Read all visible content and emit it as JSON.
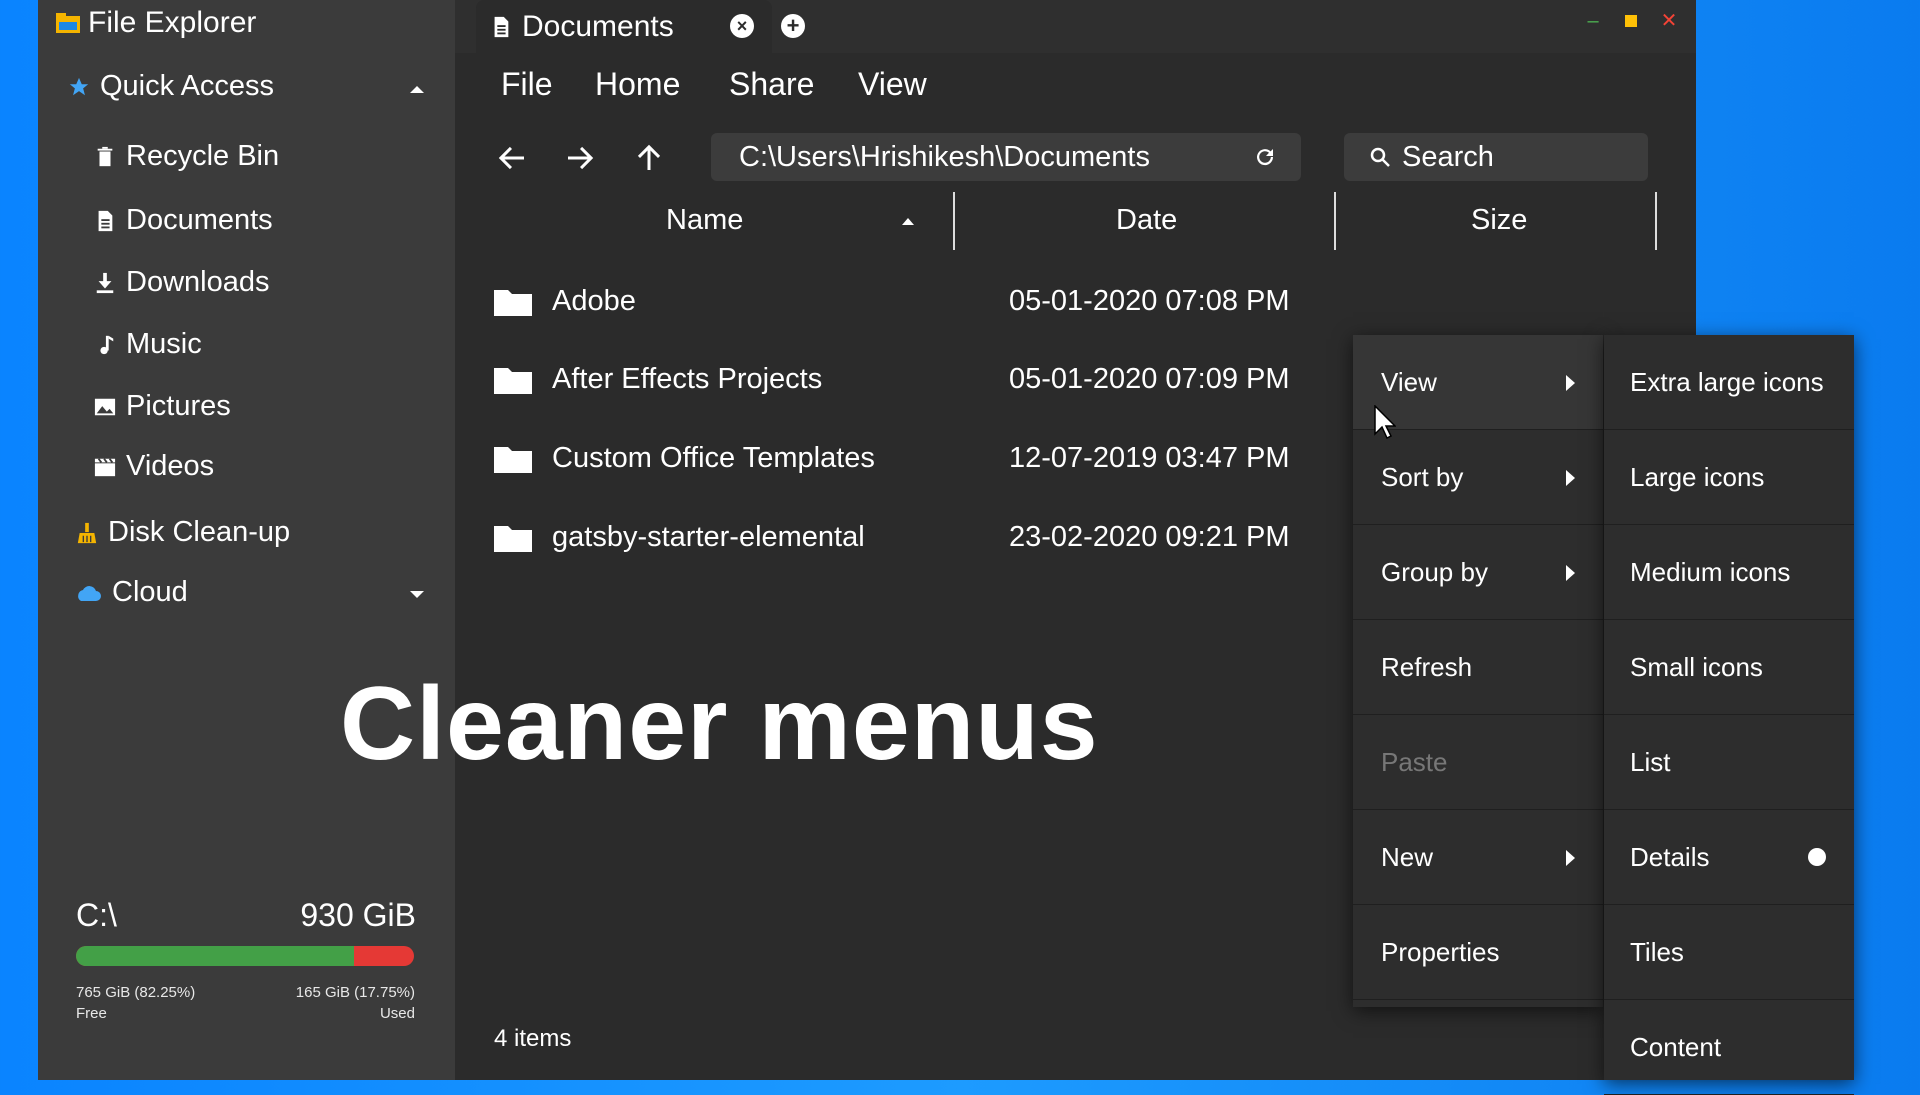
{
  "app": {
    "title": "File Explorer"
  },
  "sidebar": {
    "quick_access": "Quick Access",
    "items": [
      {
        "label": "Recycle Bin",
        "icon": "trash-icon"
      },
      {
        "label": "Documents",
        "icon": "document-icon"
      },
      {
        "label": "Downloads",
        "icon": "download-icon"
      },
      {
        "label": "Music",
        "icon": "music-note-icon"
      },
      {
        "label": "Pictures",
        "icon": "image-icon"
      },
      {
        "label": "Videos",
        "icon": "clapperboard-icon"
      }
    ],
    "disk_cleanup": "Disk Clean-up",
    "cloud": "Cloud",
    "drive": {
      "name": "C:\\",
      "size": "930 GiB",
      "free": "765 GiB (82.25%)",
      "free_label": "Free",
      "used": "165 GiB (17.75%)",
      "used_label": "Used",
      "used_fraction": 0.1775
    }
  },
  "tab": {
    "label": "Documents"
  },
  "menubar": [
    "File",
    "Home",
    "Share",
    "View"
  ],
  "address": "C:\\Users\\Hrishikesh\\Documents",
  "search": {
    "placeholder": "Search"
  },
  "columns": [
    "Name",
    "Date",
    "Size"
  ],
  "files": [
    {
      "name": "Adobe",
      "date": "05-01-2020 07:08 PM"
    },
    {
      "name": "After Effects Projects",
      "date": "05-01-2020 07:09 PM"
    },
    {
      "name": "Custom Office Templates",
      "date": "12-07-2019 03:47 PM"
    },
    {
      "name": "gatsby-starter-elemental",
      "date": "23-02-2020 09:21 PM"
    }
  ],
  "status": "4 items",
  "overlay_text": "Cleaner menus",
  "context_menu": [
    {
      "label": "View",
      "submenu": true
    },
    {
      "label": "Sort by",
      "submenu": true
    },
    {
      "label": "Group by",
      "submenu": true
    },
    {
      "label": "Refresh",
      "submenu": false
    },
    {
      "label": "Paste",
      "submenu": false,
      "disabled": true
    },
    {
      "label": "New",
      "submenu": true
    },
    {
      "label": "Properties",
      "submenu": false
    }
  ],
  "view_submenu": [
    "Extra large icons",
    "Large icons",
    "Medium icons",
    "Small icons",
    "List",
    "Details",
    "Tiles",
    "Content"
  ],
  "view_selected": "Details",
  "colors": {
    "free": "#43a047",
    "used": "#e53935",
    "minimize": "#4caf50",
    "maximize": "#ffc107",
    "close": "#f44336"
  }
}
